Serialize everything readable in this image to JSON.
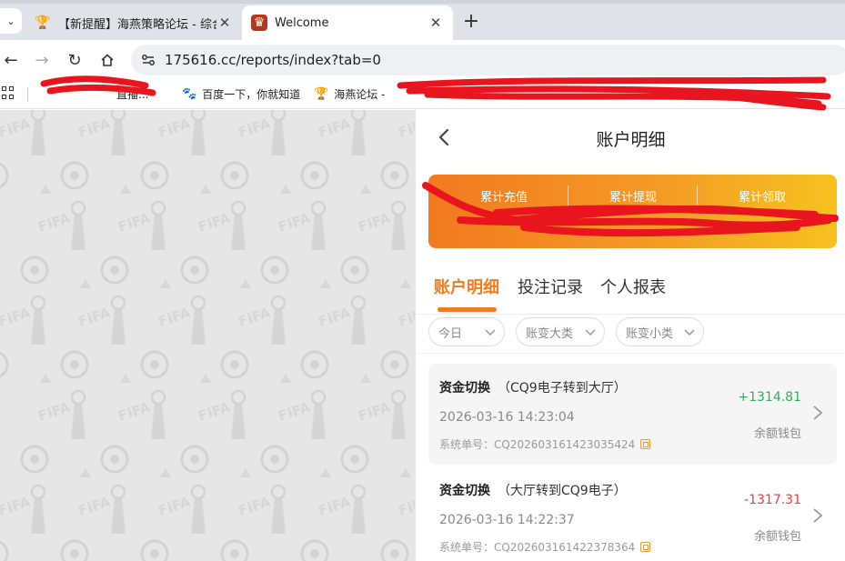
{
  "browser": {
    "tabs": [
      {
        "title": "【新提醒】海燕策略论坛 - 综合",
        "icon": "trophy-icon"
      },
      {
        "title": "Welcome",
        "icon": "app-favicon-icon"
      }
    ],
    "url": "175616.cc/reports/index?tab=0",
    "bookmarks": [
      {
        "label": "直播...",
        "icon": "bookmark-favicon-icon"
      },
      {
        "label": "百度一下，你就知道",
        "icon": "baidu-paw-icon"
      },
      {
        "label": "海燕论坛 -",
        "icon": "trophy-icon"
      }
    ]
  },
  "app": {
    "title": "账户明细",
    "summary": {
      "labels": [
        "累计充值",
        "累计提现",
        "累计领取"
      ],
      "values": [
        "",
        "",
        ""
      ]
    },
    "tabs": [
      "账户明细",
      "投注记录",
      "个人报表"
    ],
    "active_tab": 0,
    "filters": [
      "今日",
      "账变大类",
      "账变小类"
    ],
    "records": [
      {
        "type": "资金切换",
        "detail": "（CQ9电子转到大厅）",
        "time": "2026-03-16 14:23:04",
        "order_label": "系统单号：",
        "order_no": "CQ202603161423035424",
        "amount": "+1314.81",
        "wallet": "余额钱包"
      },
      {
        "type": "资金切换",
        "detail": "（大厅转到CQ9电子）",
        "time": "2026-03-16 14:22:37",
        "order_label": "系统单号：",
        "order_no": "CQ202603161422378364",
        "amount": "-1317.31",
        "wallet": "余额钱包"
      }
    ]
  },
  "colors": {
    "accent": "#f27d1f",
    "positive": "#2fae5d",
    "negative": "#e34141",
    "redaction": "#e8141e"
  }
}
